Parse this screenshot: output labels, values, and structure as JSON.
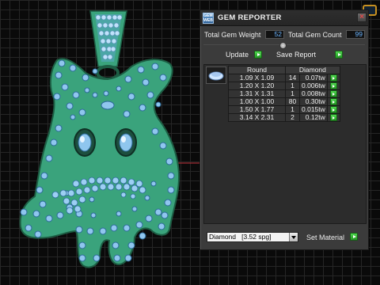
{
  "panel": {
    "logo_text": "GEM\nWEB",
    "title": "GEM REPORTER",
    "close_glyph": "×",
    "total_weight_label": "Total Gem Weight",
    "total_weight_value": "52",
    "total_count_label": "Total Gem Count",
    "total_count_value": "99",
    "update_label": "Update",
    "save_report_label": "Save Report",
    "table": {
      "headers": [
        "Round",
        "Diamond"
      ],
      "rows": [
        {
          "size": "1.09 X 1.09",
          "count": "14",
          "weight": "0.07tw"
        },
        {
          "size": "1.20 X 1.20",
          "count": "1",
          "weight": "0.006tw"
        },
        {
          "size": "1.31 X 1.31",
          "count": "1",
          "weight": "0.008tw"
        },
        {
          "size": "1.00 X 1.00",
          "count": "80",
          "weight": "0.30tw"
        },
        {
          "size": "1.50 X 1.77",
          "count": "1",
          "weight": "0.015tw"
        },
        {
          "size": "3.14 X 2.31",
          "count": "2",
          "weight": "0.12tw"
        }
      ]
    },
    "material_value": "Diamond   [3.52 spg]",
    "set_material_label": "Set Material"
  },
  "colors": {
    "model_green": "#3aa37c",
    "gem_blue": "#8fc6ee",
    "accent_green": "#2fbf2f",
    "value_blue": "#6ab4ff"
  }
}
